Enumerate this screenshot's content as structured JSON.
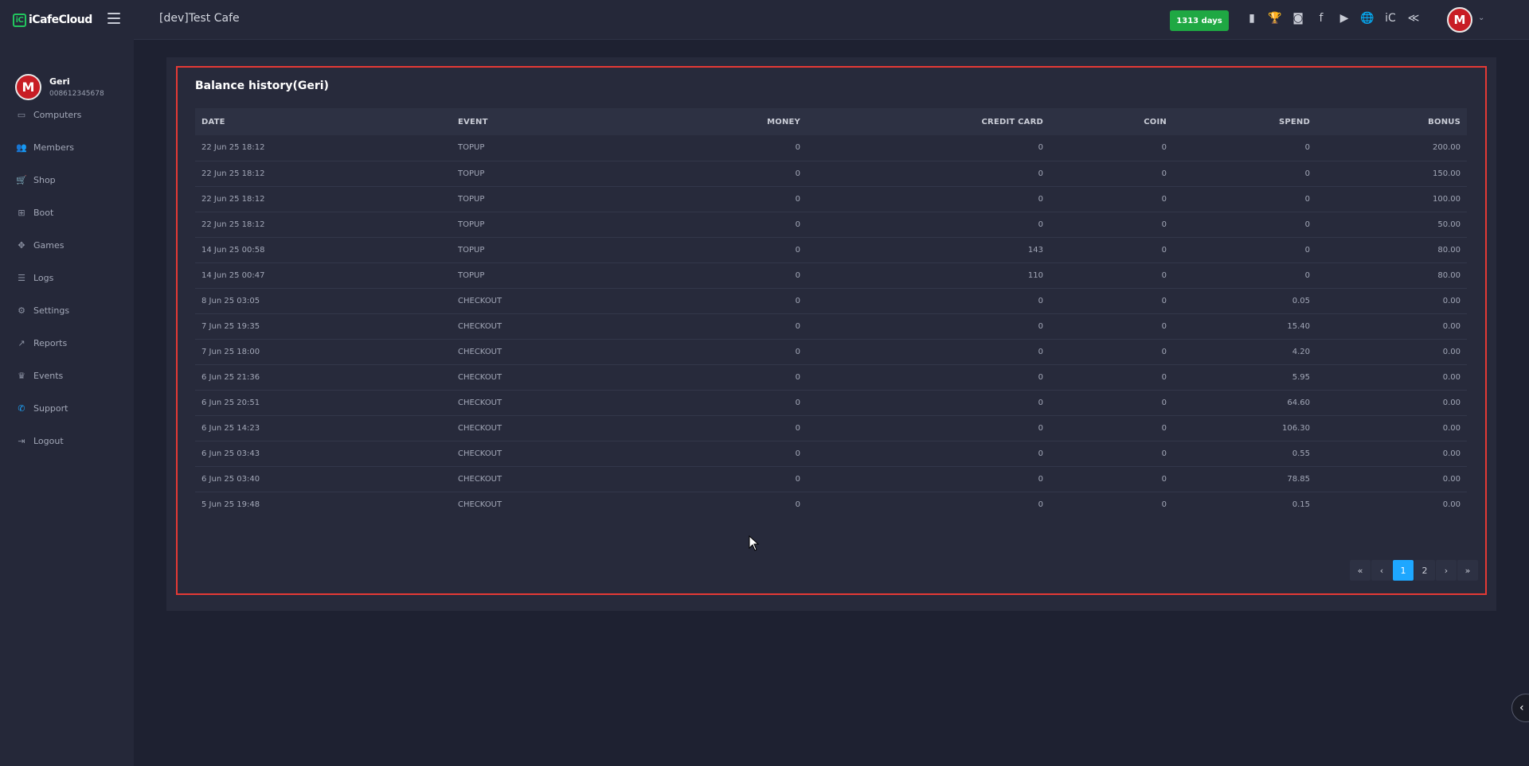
{
  "brand": {
    "logo_text": "iCafeCloud",
    "logo_mark": "iC"
  },
  "sidebar": {
    "user": {
      "name": "Geri",
      "phone": "008612345678",
      "avatar_letter": "M"
    },
    "items": [
      {
        "label": "Computers",
        "icon": "▭"
      },
      {
        "label": "Members",
        "icon": "👥"
      },
      {
        "label": "Shop",
        "icon": "🛒"
      },
      {
        "label": "Boot",
        "icon": "⊞"
      },
      {
        "label": "Games",
        "icon": "✥"
      },
      {
        "label": "Logs",
        "icon": "☰"
      },
      {
        "label": "Settings",
        "icon": "⚙"
      },
      {
        "label": "Reports",
        "icon": "↗"
      },
      {
        "label": "Events",
        "icon": "♛"
      },
      {
        "label": "Support",
        "icon": "✆"
      },
      {
        "label": "Logout",
        "icon": "⇥"
      }
    ]
  },
  "header": {
    "cafe_title": "[dev]Test Cafe",
    "days_badge": "1313 days",
    "avatar_letter": "M",
    "icons": [
      "▮",
      "🏆",
      "◙",
      "f",
      "▶",
      "🌐",
      "iC",
      "≪"
    ]
  },
  "main": {
    "title": "Balance history(Geri)",
    "columns": [
      "DATE",
      "EVENT",
      "MONEY",
      "CREDIT CARD",
      "COIN",
      "SPEND",
      "BONUS"
    ],
    "rows": [
      [
        "22 Jun 25 18:12",
        "TOPUP",
        "0",
        "0",
        "0",
        "0",
        "200.00"
      ],
      [
        "22 Jun 25 18:12",
        "TOPUP",
        "0",
        "0",
        "0",
        "0",
        "150.00"
      ],
      [
        "22 Jun 25 18:12",
        "TOPUP",
        "0",
        "0",
        "0",
        "0",
        "100.00"
      ],
      [
        "22 Jun 25 18:12",
        "TOPUP",
        "0",
        "0",
        "0",
        "0",
        "50.00"
      ],
      [
        "14 Jun 25 00:58",
        "TOPUP",
        "0",
        "143",
        "0",
        "0",
        "80.00"
      ],
      [
        "14 Jun 25 00:47",
        "TOPUP",
        "0",
        "110",
        "0",
        "0",
        "80.00"
      ],
      [
        "8 Jun 25 03:05",
        "CHECKOUT",
        "0",
        "0",
        "0",
        "0.05",
        "0.00"
      ],
      [
        "7 Jun 25 19:35",
        "CHECKOUT",
        "0",
        "0",
        "0",
        "15.40",
        "0.00"
      ],
      [
        "7 Jun 25 18:00",
        "CHECKOUT",
        "0",
        "0",
        "0",
        "4.20",
        "0.00"
      ],
      [
        "6 Jun 25 21:36",
        "CHECKOUT",
        "0",
        "0",
        "0",
        "5.95",
        "0.00"
      ],
      [
        "6 Jun 25 20:51",
        "CHECKOUT",
        "0",
        "0",
        "0",
        "64.60",
        "0.00"
      ],
      [
        "6 Jun 25 14:23",
        "CHECKOUT",
        "0",
        "0",
        "0",
        "106.30",
        "0.00"
      ],
      [
        "6 Jun 25 03:43",
        "CHECKOUT",
        "0",
        "0",
        "0",
        "0.55",
        "0.00"
      ],
      [
        "6 Jun 25 03:40",
        "CHECKOUT",
        "0",
        "0",
        "0",
        "78.85",
        "0.00"
      ],
      [
        "5 Jun 25 19:48",
        "CHECKOUT",
        "0",
        "0",
        "0",
        "0.15",
        "0.00"
      ]
    ],
    "pagination": {
      "first": "«",
      "prev": "‹",
      "pages": [
        "1",
        "2"
      ],
      "active_page": "1",
      "next": "›",
      "last": "»"
    }
  },
  "float_button": {
    "icon": "‹"
  },
  "colors": {
    "background": "#1e2131",
    "panel": "#252839",
    "card": "#272a3b",
    "accent_blue": "#1ea7ff",
    "badge_green": "#1fa843",
    "highlight_red": "#e53935"
  }
}
